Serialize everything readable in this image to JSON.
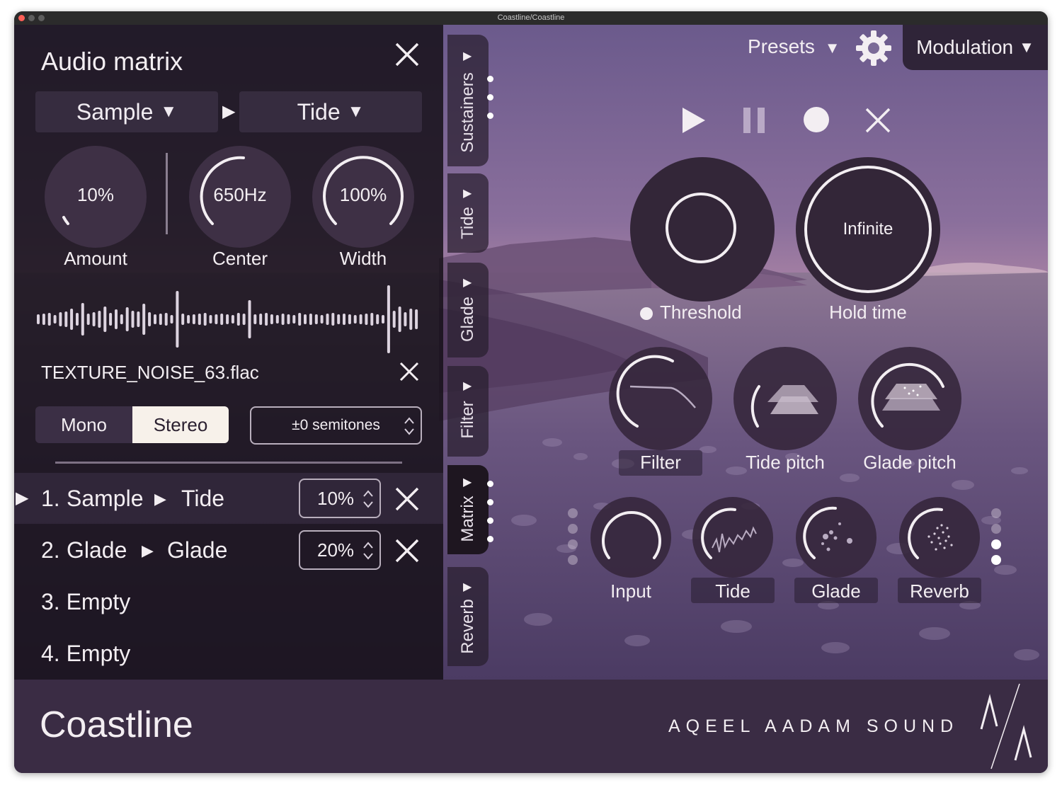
{
  "window": {
    "title": "Coastline/Coastline"
  },
  "audio_matrix": {
    "title": "Audio matrix",
    "source": "Sample",
    "destination": "Tide",
    "knobs": [
      {
        "label": "Amount",
        "value": "10%"
      },
      {
        "label": "Center",
        "value": "650Hz"
      },
      {
        "label": "Width",
        "value": "100%"
      }
    ],
    "file_name": "TEXTURE_NOISE_63.flac",
    "mono_label": "Mono",
    "stereo_label": "Stereo",
    "selected_channel": "Stereo",
    "semitones": "±0 semitones",
    "rows": [
      {
        "index": "1.",
        "source": "Sample",
        "dest": "Tide",
        "amount": "10%",
        "selected": true
      },
      {
        "index": "2.",
        "source": "Glade",
        "dest": "Glade",
        "amount": "20%",
        "selected": false
      }
    ],
    "empty_rows": [
      {
        "label": "3. Empty"
      },
      {
        "label": "4. Empty"
      }
    ]
  },
  "side_tabs": [
    {
      "label": "Sustainers",
      "active": false
    },
    {
      "label": "Tide",
      "active": false
    },
    {
      "label": "Glade",
      "active": false
    },
    {
      "label": "Filter",
      "active": false
    },
    {
      "label": "Matrix",
      "active": true
    },
    {
      "label": "Reverb",
      "active": false
    }
  ],
  "header": {
    "presets_label": "Presets",
    "modulation_label": "Modulation"
  },
  "transport": {
    "icons": [
      "play-icon",
      "pause-icon",
      "record-icon",
      "stop-icon"
    ]
  },
  "main_knobs": {
    "threshold_label": "Threshold",
    "hold_time_label": "Hold time",
    "hold_time_value": "Infinite",
    "row2": [
      {
        "label": "Filter"
      },
      {
        "label": "Tide pitch"
      },
      {
        "label": "Glade pitch"
      }
    ],
    "row3": [
      {
        "label": "Input"
      },
      {
        "label": "Tide"
      },
      {
        "label": "Glade"
      },
      {
        "label": "Reverb"
      }
    ]
  },
  "footer": {
    "product": "Coastline",
    "brand": "AQEEL AADAM SOUND"
  },
  "colors": {
    "panel_dark": "#161018",
    "footer": "#3a2c44",
    "accent_white": "#f3eef2",
    "sky_top": "#6d5b8e",
    "sky_horizon": "#c794ac"
  }
}
